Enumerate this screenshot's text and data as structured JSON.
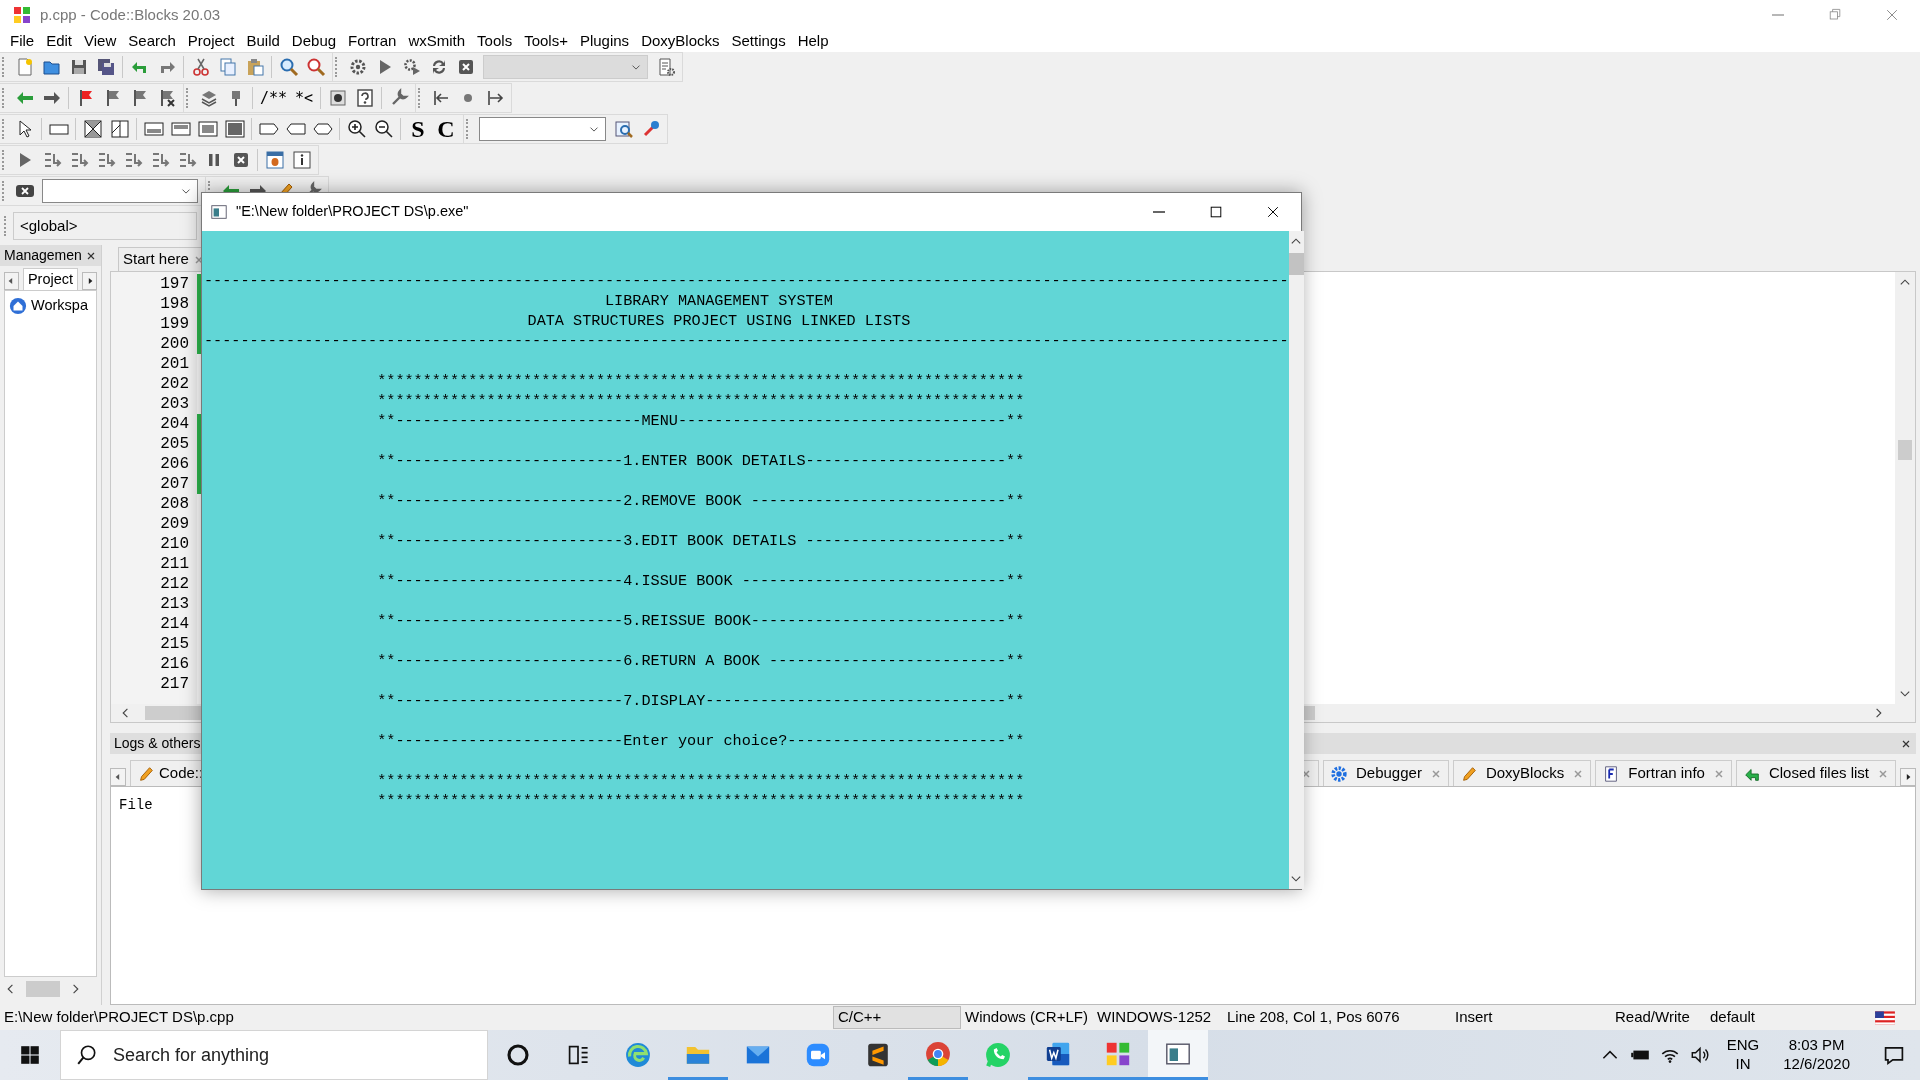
{
  "window": {
    "title": "p.cpp - Code::Blocks 20.03"
  },
  "menu": [
    "File",
    "Edit",
    "View",
    "Search",
    "Project",
    "Build",
    "Debug",
    "Fortran",
    "wxSmith",
    "Tools",
    "Tools+",
    "Plugins",
    "DoxyBlocks",
    "Settings",
    "Help"
  ],
  "toolbar_texts": {
    "comment": [
      "/**",
      "*<"
    ],
    "style": [
      "S",
      "C"
    ]
  },
  "scope": {
    "value": "<global>"
  },
  "management": {
    "title": "Managemen",
    "tabs": [
      {
        "label": "Project",
        "selected": true
      }
    ],
    "tree": [
      {
        "label": "Workspa"
      }
    ]
  },
  "editor": {
    "tabs": [
      {
        "label": "Start here",
        "selected": false
      }
    ],
    "lines": [
      {
        "number": "197",
        "changed": true
      },
      {
        "number": "198",
        "changed": true
      },
      {
        "number": "199",
        "changed": true
      },
      {
        "number": "200",
        "changed": true
      },
      {
        "number": "201",
        "changed": false
      },
      {
        "number": "202",
        "changed": false
      },
      {
        "number": "203",
        "changed": false
      },
      {
        "number": "204",
        "changed": true
      },
      {
        "number": "205",
        "changed": true
      },
      {
        "number": "206",
        "changed": true
      },
      {
        "number": "207",
        "changed": true
      },
      {
        "number": "208",
        "changed": false
      },
      {
        "number": "209",
        "changed": false
      },
      {
        "number": "210",
        "changed": false
      },
      {
        "number": "211",
        "changed": false
      },
      {
        "number": "212",
        "changed": false
      },
      {
        "number": "213",
        "changed": false
      },
      {
        "number": "214",
        "changed": false
      },
      {
        "number": "215",
        "changed": false
      },
      {
        "number": "216",
        "changed": false
      },
      {
        "number": "217",
        "changed": false
      }
    ]
  },
  "logs": {
    "title": "Logs & others",
    "tabs": [
      {
        "label": "Code::"
      },
      {
        "label": "Debugger"
      },
      {
        "label": "DoxyBlocks"
      },
      {
        "label": "Fortran info"
      },
      {
        "label": "Closed files list"
      }
    ],
    "column": "File"
  },
  "console": {
    "title": "\"E:\\New folder\\PROJECT DS\\p.exe\"",
    "lines": [
      {
        "kind": "rule",
        "text": "-----------------------------------------------------------------------------------------------------------------------"
      },
      {
        "kind": "title",
        "text": "LIBRARY MANAGEMENT SYSTEM"
      },
      {
        "kind": "title",
        "text": "DATA STRUCTURES PROJECT USING LINKED LISTS"
      },
      {
        "kind": "rule",
        "text": "-----------------------------------------------------------------------------------------------------------------------"
      },
      {
        "kind": "stars",
        "text": "***********************************************************************"
      },
      {
        "kind": "stars",
        "text": "***********************************************************************"
      },
      {
        "kind": "menu",
        "text": "**---------------------------MENU------------------------------------**"
      },
      {
        "kind": "menu",
        "text": "**-------------------------1.ENTER BOOK DETAILS----------------------**"
      },
      {
        "kind": "menu",
        "text": "**-------------------------2.REMOVE BOOK ----------------------------**"
      },
      {
        "kind": "menu",
        "text": "**-------------------------3.EDIT BOOK DETAILS ----------------------**"
      },
      {
        "kind": "menu",
        "text": "**-------------------------4.ISSUE BOOK -----------------------------**"
      },
      {
        "kind": "menu",
        "text": "**-------------------------5.REISSUE BOOK----------------------------**"
      },
      {
        "kind": "menu",
        "text": "**-------------------------6.RETURN A BOOK --------------------------**"
      },
      {
        "kind": "menu",
        "text": "**-------------------------7.DISPLAY---------------------------------**"
      },
      {
        "kind": "menu",
        "text": "**-------------------------Enter your choice?------------------------**"
      },
      {
        "kind": "stars",
        "text": "***********************************************************************"
      },
      {
        "kind": "stars",
        "text": "***********************************************************************"
      }
    ]
  },
  "status_bar": [
    "E:\\New folder\\PROJECT DS\\p.cpp",
    "C/C++",
    "Windows (CR+LF)",
    "WINDOWS-1252",
    "Line 208, Col 1, Pos 6076",
    "Insert",
    "Read/Write",
    "default"
  ],
  "taskbar": {
    "search": {
      "placeholder": "Search for anything"
    },
    "apps": [
      {
        "running": false,
        "selected": false
      },
      {
        "running": true,
        "selected": false
      },
      {
        "running": false,
        "selected": false
      },
      {
        "running": false,
        "selected": false
      },
      {
        "running": false,
        "selected": false
      },
      {
        "running": true,
        "selected": false
      },
      {
        "running": false,
        "selected": false
      },
      {
        "running": true,
        "selected": false
      },
      {
        "running": true,
        "selected": false
      },
      {
        "running": true,
        "selected": true
      }
    ],
    "language": [
      "ENG",
      "IN"
    ],
    "time": "8:03 PM",
    "date": "12/6/2020"
  }
}
